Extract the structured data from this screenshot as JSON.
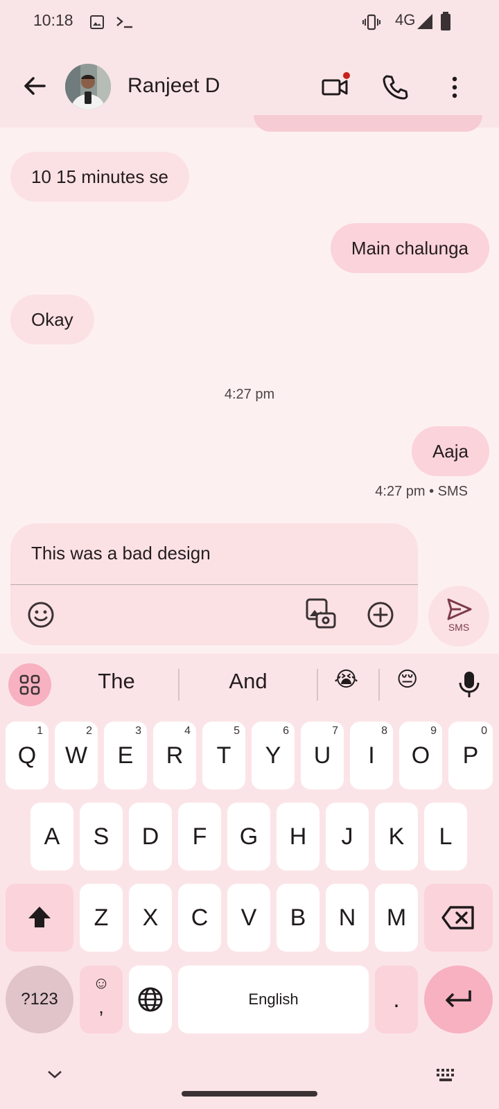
{
  "status_bar": {
    "time": "10:18",
    "network": "4G",
    "icons": [
      "image-icon",
      "terminal-icon",
      "vibrate-icon",
      "signal-icon",
      "battery-icon"
    ]
  },
  "app_bar": {
    "contact_name": "Ranjeet D",
    "icons": [
      "back-arrow-icon",
      "video-call-icon",
      "phone-icon",
      "more-vert-icon"
    ]
  },
  "messages": [
    {
      "direction": "in",
      "text": "10 15 minutes se"
    },
    {
      "direction": "out",
      "text": "Main chalunga"
    },
    {
      "direction": "in",
      "text": "Okay"
    },
    {
      "direction": "out",
      "text": "Aaja"
    }
  ],
  "timestamps": {
    "divider": "4:27 pm",
    "last_message_meta": "4:27 pm • SMS"
  },
  "compose": {
    "text": "This was a bad design",
    "send_label": "SMS",
    "icons": [
      "emoji-icon",
      "gallery-icon",
      "add-icon",
      "send-icon"
    ]
  },
  "keyboard": {
    "suggestions": [
      "The",
      "And"
    ],
    "emoji_suggestions": [
      "😭",
      "😔"
    ],
    "row1": [
      {
        "label": "Q",
        "hint": "1"
      },
      {
        "label": "W",
        "hint": "2"
      },
      {
        "label": "E",
        "hint": "3"
      },
      {
        "label": "R",
        "hint": "4"
      },
      {
        "label": "T",
        "hint": "5"
      },
      {
        "label": "Y",
        "hint": "6"
      },
      {
        "label": "U",
        "hint": "7"
      },
      {
        "label": "I",
        "hint": "8"
      },
      {
        "label": "O",
        "hint": "9"
      },
      {
        "label": "P",
        "hint": "0"
      }
    ],
    "row2": [
      "A",
      "S",
      "D",
      "F",
      "G",
      "H",
      "J",
      "K",
      "L"
    ],
    "row3": [
      "Z",
      "X",
      "C",
      "V",
      "B",
      "N",
      "M"
    ],
    "symbols_label": "?123",
    "comma_label": ",",
    "emoji_key": "☺",
    "space_label": "English",
    "period_label": ".",
    "accent": "#f7b1c1"
  }
}
